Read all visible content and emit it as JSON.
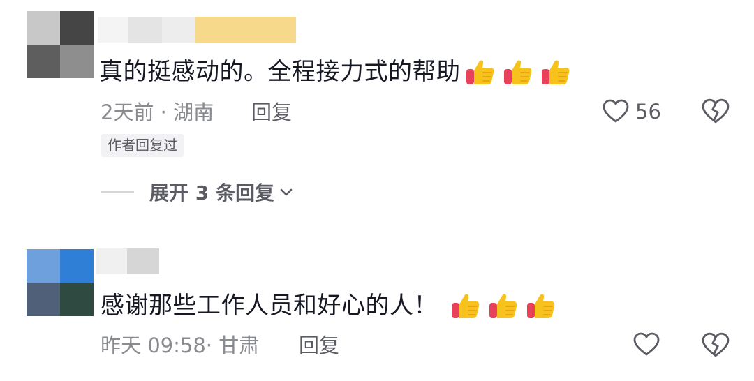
{
  "comments": [
    {
      "avatar_colors": [
        "#c8c8c8",
        "#454545",
        "#5e5e5e",
        "#8e8e8e"
      ],
      "name_blur_colors": [
        "#f4f4f4",
        "#e4e4e4",
        "#ededed",
        "#f6d98a"
      ],
      "text": "真的挺感动的。全程接力式的帮助",
      "emoji": [
        "thumbs-up",
        "thumbs-up",
        "thumbs-up"
      ],
      "meta": "2天前 · 湖南",
      "reply_label": "回复",
      "likes": "56",
      "badge": "作者回复过",
      "expand_label": "展开 3 条回复"
    },
    {
      "avatar_colors": [
        "#6fa0de",
        "#2f7fd6",
        "#4f6078",
        "#2f4a40"
      ],
      "name_blur_colors": [
        "#f0f0f0",
        "#d6d6d6"
      ],
      "text": "感谢那些工作人员和好心的人！",
      "emoji": [
        "thumbs-up",
        "thumbs-up",
        "thumbs-up"
      ],
      "meta": "昨天 09:58· 甘肃",
      "reply_label": "回复",
      "likes": ""
    }
  ],
  "colors": {
    "text_primary": "#161823",
    "text_meta": "#8a8b91",
    "icon": "#5b5c63",
    "thumb_yellow": "#f8c21c",
    "thumb_cuff": "#e8425a"
  }
}
